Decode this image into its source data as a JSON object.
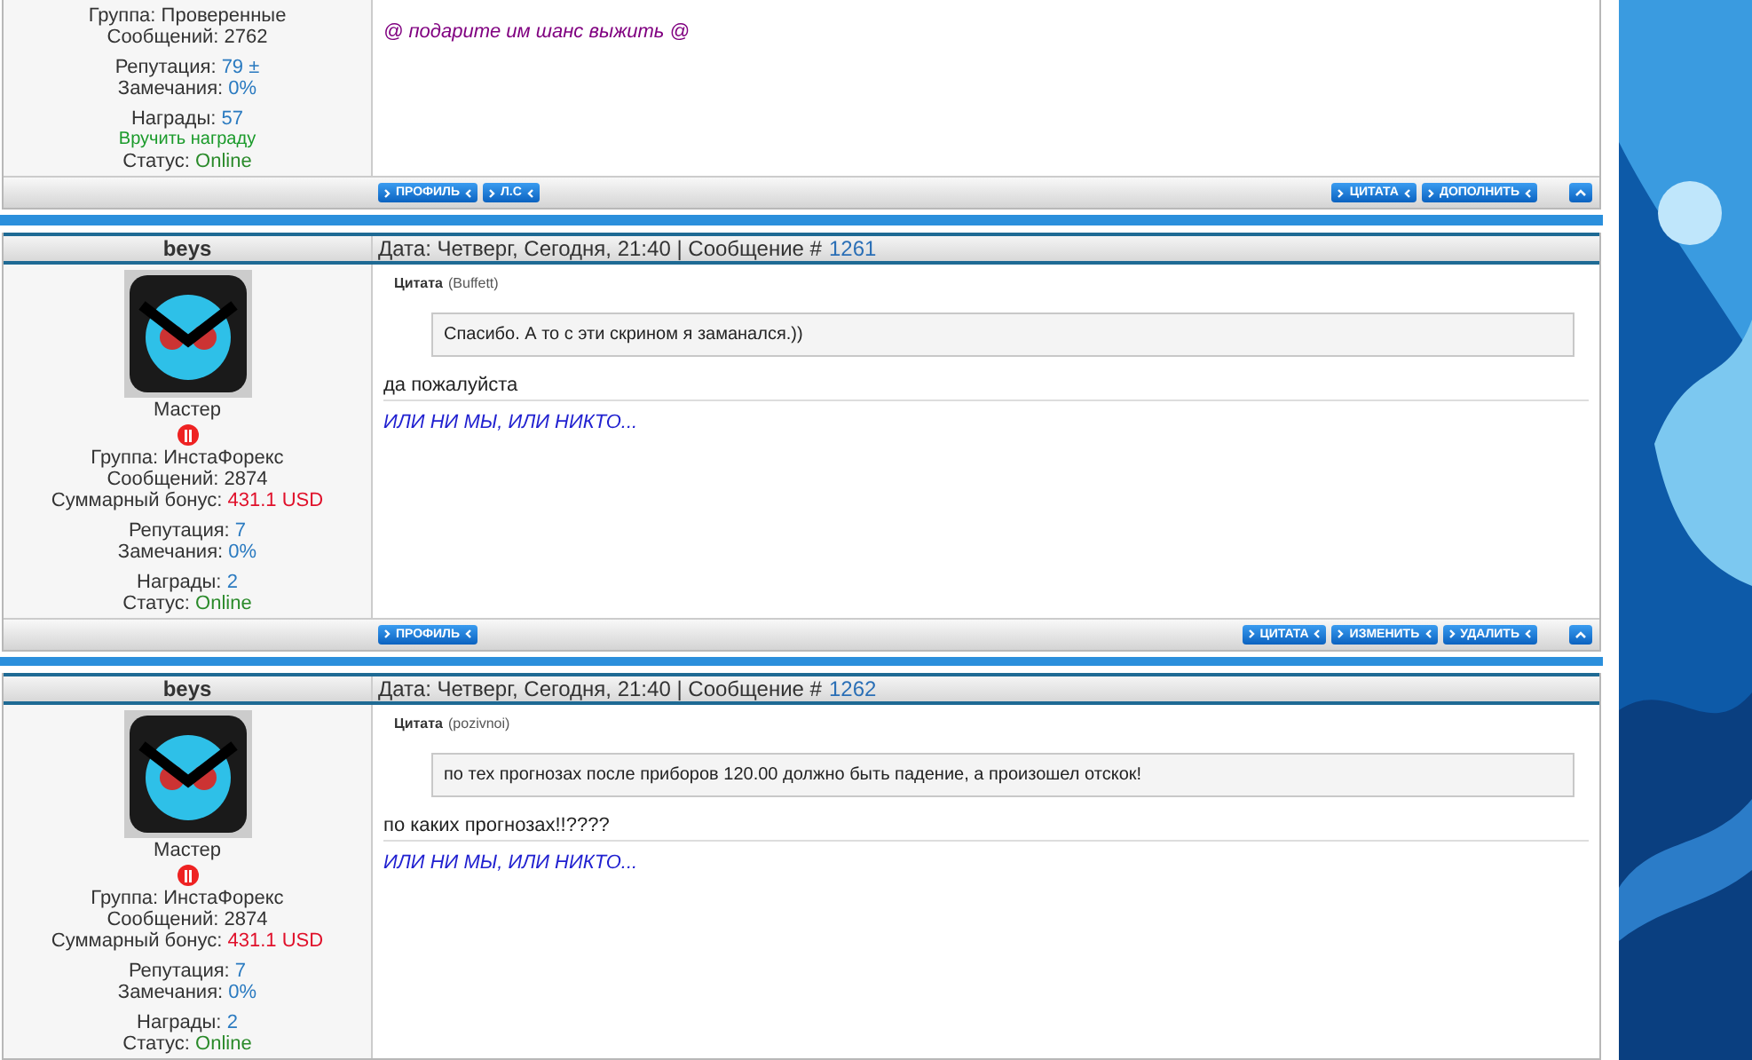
{
  "posts": [
    {
      "user": {
        "stat_groups": [
          [
            {
              "label": "Группа:",
              "value": "Проверенные"
            },
            {
              "label": "Сообщений:",
              "value": "2762"
            }
          ],
          [
            {
              "label": "Репутация:",
              "value": "79",
              "color": "#2a7ac0",
              "extra": "±"
            },
            {
              "label": "Замечания:",
              "value": "0%",
              "color": "#2a7ac0"
            }
          ],
          [
            {
              "label": "Награды:",
              "value": "57",
              "color": "#2a7ac0"
            },
            {
              "link": "Вручить награду"
            },
            {
              "label": "Статус:",
              "value": "Online",
              "color": "#2a8a2a"
            }
          ]
        ]
      },
      "signature": "@ подарите им шанс выжить @",
      "color": "#800080",
      "left_buttons": [
        "ПРОФИЛЬ",
        "Л.С"
      ],
      "right_buttons": [
        "ЦИТАТА",
        "ДОПОЛНИТЬ"
      ]
    },
    {
      "header": {
        "author": "beys",
        "date": "Дата: Четверг, Сегодня, 21:40 | Сообщение #",
        "number": "1261"
      },
      "user": {
        "avatar": true,
        "rank": "Мастер",
        "stat_groups": [
          [
            {
              "label": "Группа:",
              "value": "ИнстаФорекс"
            },
            {
              "label": "Сообщений:",
              "value": "2874"
            },
            {
              "label": "Суммарный бонус:",
              "value": "431.1 USD",
              "color": "#e0102a"
            }
          ],
          [
            {
              "label": "Репутация:",
              "value": "7",
              "color": "#2a7ac0"
            },
            {
              "label": "Замечания:",
              "value": "0%",
              "color": "#2a7ac0"
            }
          ],
          [
            {
              "label": "Награды:",
              "value": "2",
              "color": "#2a7ac0"
            },
            {
              "label": "Статус:",
              "value": "Online",
              "color": "#2a8a2a"
            }
          ]
        ]
      },
      "quote": {
        "title": "Цитата",
        "author": "(Buffett)",
        "text": "Спасибо. А то с эти скрином я заманался.))"
      },
      "text": "да пожалуйста",
      "signature": "ИЛИ НИ МЫ, ИЛИ НИКТО...",
      "color": "#2020d0",
      "left_buttons": [
        "ПРОФИЛЬ"
      ],
      "right_buttons": [
        "ЦИТАТА",
        "ИЗМЕНИТЬ",
        "УДАЛИТЬ"
      ]
    },
    {
      "header": {
        "author": "beys",
        "date": "Дата: Четверг, Сегодня, 21:40 | Сообщение #",
        "number": "1262"
      },
      "user": {
        "avatar": true,
        "rank": "Мастер",
        "stat_groups": [
          [
            {
              "label": "Группа:",
              "value": "ИнстаФорекс"
            },
            {
              "label": "Сообщений:",
              "value": "2874"
            },
            {
              "label": "Суммарный бонус:",
              "value": "431.1 USD",
              "color": "#e0102a"
            }
          ],
          [
            {
              "label": "Репутация:",
              "value": "7",
              "color": "#2a7ac0"
            },
            {
              "label": "Замечания:",
              "value": "0%",
              "color": "#2a7ac0"
            }
          ],
          [
            {
              "label": "Награды:",
              "value": "2",
              "color": "#2a7ac0"
            },
            {
              "label": "Статус:",
              "value": "Online",
              "color": "#2a8a2a"
            }
          ]
        ]
      },
      "quote": {
        "title": "Цитата",
        "author": "(pozivnoi)",
        "text": "по тех прогнозах после приборов 120.00 должно быть падение, а произошел отскок!"
      },
      "text": "по каких прогнозах!!????",
      "signature": "ИЛИ НИ МЫ, ИЛИ НИКТО...",
      "color": "#2020d0"
    }
  ]
}
